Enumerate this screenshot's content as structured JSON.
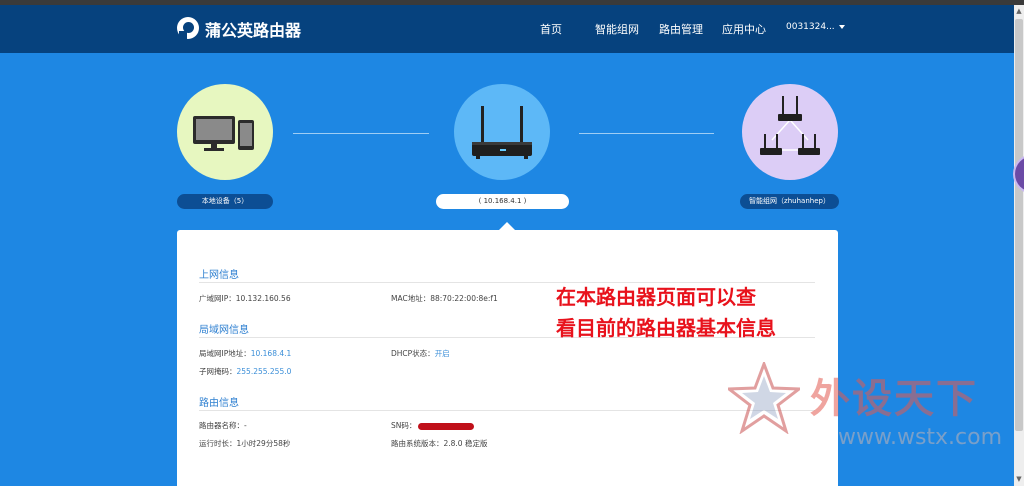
{
  "navbar": {
    "brand": "蒲公英路由器",
    "items": [
      "首页",
      "智能组网",
      "路由管理",
      "应用中心"
    ],
    "user": "0031324..."
  },
  "topology": {
    "local_label": "本地设备（5）",
    "router_label": "( 10.168.4.1 )",
    "mesh_label": "智能组网（zhuhanhep）"
  },
  "sections": {
    "wan": {
      "title": "上网信息",
      "wan_ip_label": "广域网IP：",
      "wan_ip": "10.132.160.56",
      "mac_label": "MAC地址：",
      "mac": "88:70:22:00:8e:f1"
    },
    "lan": {
      "title": "局域网信息",
      "lan_ip_label": "局域网IP地址：",
      "lan_ip": "10.168.4.1",
      "dhcp_label": "DHCP状态：",
      "dhcp": "开启",
      "mask_label": "子网掩码：",
      "mask": "255.255.255.0"
    },
    "router": {
      "title": "路由信息",
      "name_label": "路由器名称：",
      "name": "-",
      "sn_label": "SN码：",
      "uptime_label": "运行时长：",
      "uptime": "1小时29分58秒",
      "version_label": "路由系统版本：",
      "version": "2.8.0 稳定版"
    }
  },
  "annotation": {
    "line1": "在本路由器页面可以查",
    "line2": "看目前的路由器基本信息"
  },
  "watermark": {
    "text": "外设天下",
    "url": "www.wstx.com"
  },
  "colors": {
    "background": "#1e87e3",
    "navbar": "#06427e",
    "section_title": "#2d7fd0",
    "annotation": "#e8121c"
  }
}
